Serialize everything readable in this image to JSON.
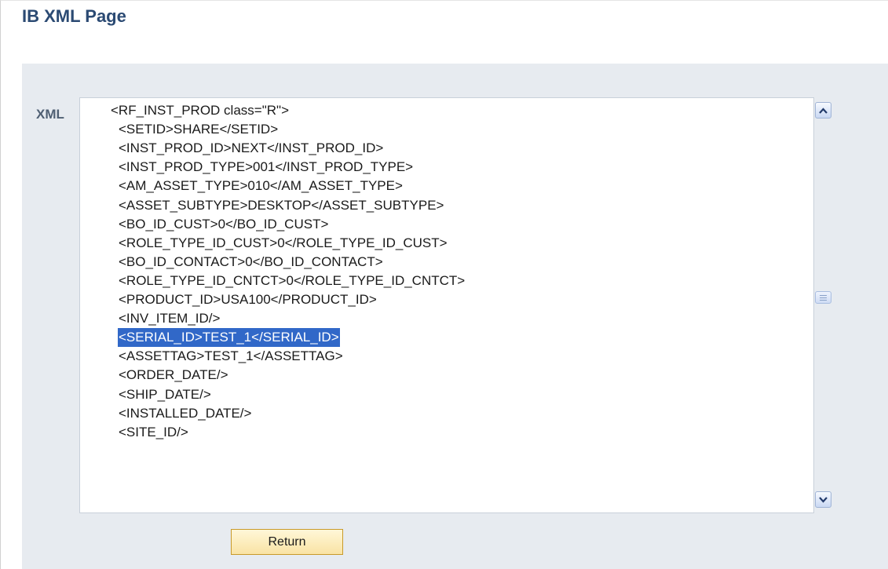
{
  "page": {
    "title": "IB XML Page"
  },
  "xml_field": {
    "label": "XML",
    "lines": [
      "<RF_INST_PROD class=\"R\">",
      "<SETID>SHARE</SETID>",
      "<INST_PROD_ID>NEXT</INST_PROD_ID>",
      "<INST_PROD_TYPE>001</INST_PROD_TYPE>",
      "<AM_ASSET_TYPE>010</AM_ASSET_TYPE>",
      "<ASSET_SUBTYPE>DESKTOP</ASSET_SUBTYPE>",
      "<BO_ID_CUST>0</BO_ID_CUST>",
      "<ROLE_TYPE_ID_CUST>0</ROLE_TYPE_ID_CUST>",
      "<BO_ID_CONTACT>0</BO_ID_CONTACT>",
      "<ROLE_TYPE_ID_CNTCT>0</ROLE_TYPE_ID_CNTCT>",
      "<PRODUCT_ID>USA100</PRODUCT_ID>",
      "<INV_ITEM_ID/>",
      "<SERIAL_ID>TEST_1</SERIAL_ID>",
      "<ASSETTAG>TEST_1</ASSETTAG>",
      "<ORDER_DATE/>",
      "<SHIP_DATE/>",
      "<INSTALLED_DATE/>",
      "<SITE_ID/>"
    ],
    "selected_line_index": 12
  },
  "actions": {
    "return_label": "Return"
  },
  "colors": {
    "title": "#2b4a73",
    "panel_background": "#e7ebf0",
    "selection": "#3168c8",
    "button_fill": "#f9e3a4",
    "button_border": "#c89a2a"
  }
}
